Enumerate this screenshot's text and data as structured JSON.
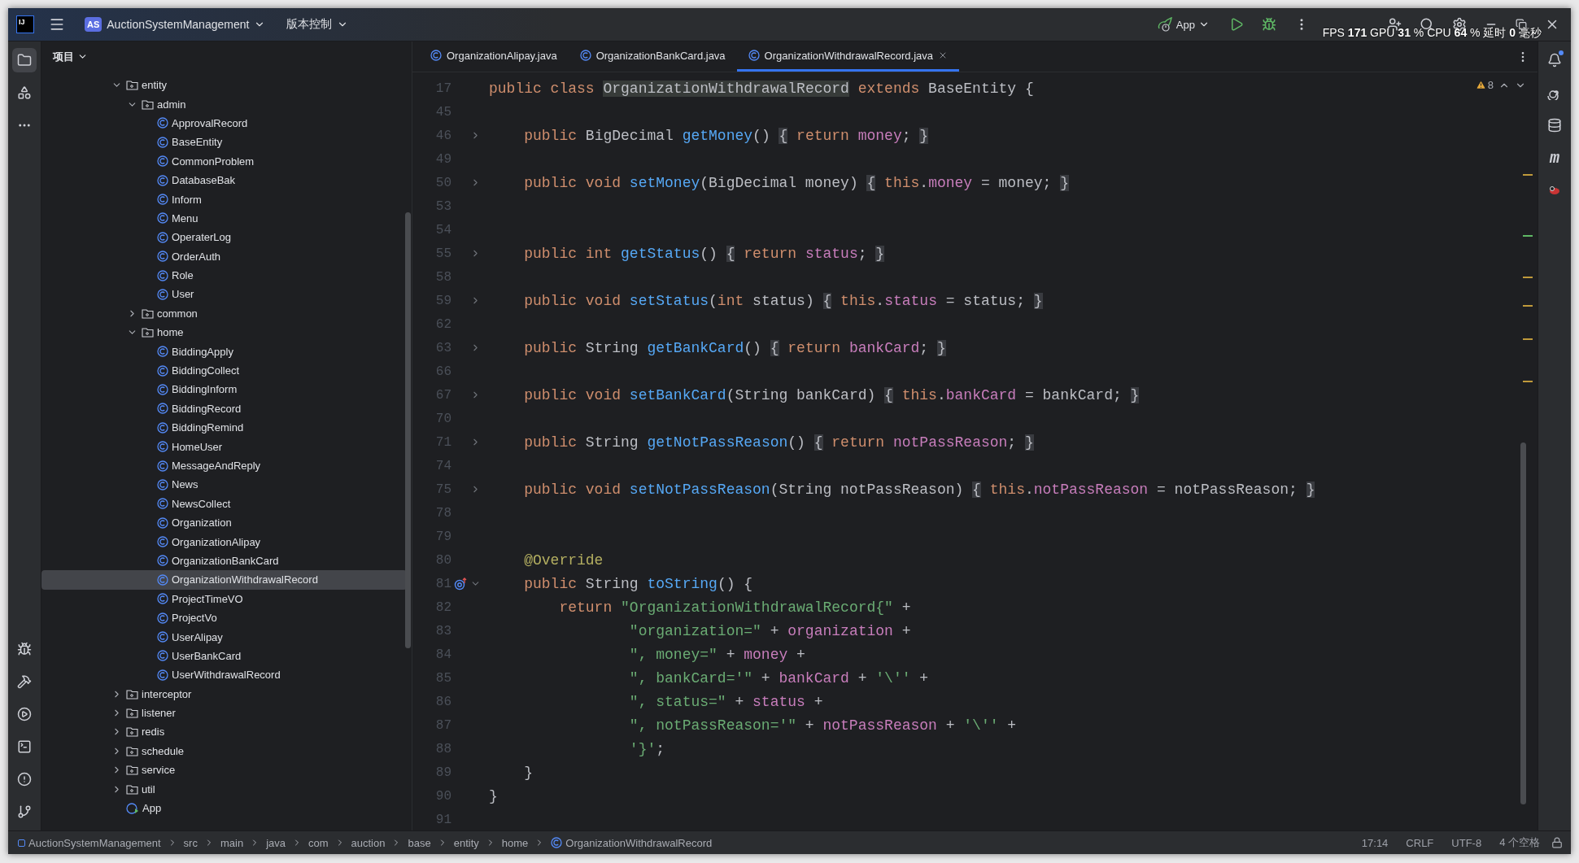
{
  "titlebar": {
    "logo_text": "IJ",
    "project_badge": "AS",
    "project_name": "AuctionSystemManagement",
    "vcs": "版本控制",
    "run_config": "App",
    "perf_overlay": "FPS **171** GPU **31** % CPU **64** % 延时 **0** 毫秒"
  },
  "right_strip": {
    "maven_label": "m"
  },
  "project": {
    "title": "项目",
    "tree": [
      {
        "label": "entity",
        "kind": "folder",
        "expanded": true,
        "selected": false,
        "children": [
          {
            "label": "admin",
            "kind": "folder",
            "expanded": true,
            "selected": false,
            "children": [
              {
                "label": "ApprovalRecord",
                "kind": "class",
                "selected": false
              },
              {
                "label": "BaseEntity",
                "kind": "class",
                "selected": false
              },
              {
                "label": "CommonProblem",
                "kind": "class",
                "selected": false
              },
              {
                "label": "DatabaseBak",
                "kind": "class",
                "selected": false
              },
              {
                "label": "Inform",
                "kind": "class",
                "selected": false
              },
              {
                "label": "Menu",
                "kind": "class",
                "selected": false
              },
              {
                "label": "OperaterLog",
                "kind": "class",
                "selected": false
              },
              {
                "label": "OrderAuth",
                "kind": "class",
                "selected": false
              },
              {
                "label": "Role",
                "kind": "class",
                "selected": false
              },
              {
                "label": "User",
                "kind": "class",
                "selected": false
              }
            ]
          },
          {
            "label": "common",
            "kind": "folder",
            "expanded": false,
            "selected": false
          },
          {
            "label": "home",
            "kind": "folder",
            "expanded": true,
            "selected": false,
            "children": [
              {
                "label": "BiddingApply",
                "kind": "class",
                "selected": false
              },
              {
                "label": "BiddingCollect",
                "kind": "class",
                "selected": false
              },
              {
                "label": "BiddingInform",
                "kind": "class",
                "selected": false
              },
              {
                "label": "BiddingRecord",
                "kind": "class",
                "selected": false
              },
              {
                "label": "BiddingRemind",
                "kind": "class",
                "selected": false
              },
              {
                "label": "HomeUser",
                "kind": "class",
                "selected": false
              },
              {
                "label": "MessageAndReply",
                "kind": "class",
                "selected": false
              },
              {
                "label": "News",
                "kind": "class",
                "selected": false
              },
              {
                "label": "NewsCollect",
                "kind": "class",
                "selected": false
              },
              {
                "label": "Organization",
                "kind": "class",
                "selected": false
              },
              {
                "label": "OrganizationAlipay",
                "kind": "class",
                "selected": false
              },
              {
                "label": "OrganizationBankCard",
                "kind": "class",
                "selected": false
              },
              {
                "label": "OrganizationWithdrawalRecord",
                "kind": "class",
                "selected": true
              },
              {
                "label": "ProjectTimeVO",
                "kind": "class",
                "selected": false
              },
              {
                "label": "ProjectVo",
                "kind": "class",
                "selected": false
              },
              {
                "label": "UserAlipay",
                "kind": "class",
                "selected": false
              },
              {
                "label": "UserBankCard",
                "kind": "class",
                "selected": false
              },
              {
                "label": "UserWithdrawalRecord",
                "kind": "class",
                "selected": false
              }
            ]
          }
        ]
      },
      {
        "label": "interceptor",
        "kind": "folder",
        "expanded": false,
        "selected": false
      },
      {
        "label": "listener",
        "kind": "folder",
        "expanded": false,
        "selected": false
      },
      {
        "label": "redis",
        "kind": "folder",
        "expanded": false,
        "selected": false
      },
      {
        "label": "schedule",
        "kind": "folder",
        "expanded": false,
        "selected": false
      },
      {
        "label": "service",
        "kind": "folder",
        "expanded": false,
        "selected": false
      },
      {
        "label": "util",
        "kind": "folder",
        "expanded": false,
        "selected": false
      },
      {
        "label": "App",
        "kind": "app",
        "selected": false
      }
    ]
  },
  "tabs": [
    {
      "label": "OrganizationAlipay.java",
      "selected": false
    },
    {
      "label": "OrganizationBankCard.java",
      "selected": false
    },
    {
      "label": "OrganizationWithdrawalRecord.java",
      "selected": true
    }
  ],
  "editor": {
    "warnings": "8",
    "lines": [
      {
        "number": "17",
        "tokens": [
          {
            "kind": "kw",
            "text": "public class "
          },
          {
            "kind": "highlight",
            "text": "OrganizationWithdrawalRecord"
          },
          {
            "kind": "kw",
            "text": " extends "
          },
          {
            "kind": "plain",
            "text": "BaseEntity {"
          }
        ]
      },
      {
        "number": "45"
      },
      {
        "number": "46",
        "fold_expanded": false,
        "tokens": [
          {
            "kind": "kw",
            "text": "    public "
          },
          {
            "kind": "plain",
            "text": "BigDecimal "
          },
          {
            "kind": "method",
            "text": "getMoney"
          },
          {
            "kind": "plain",
            "text": "() "
          },
          {
            "kind": "fold",
            "text": "{"
          },
          {
            "kind": "kw",
            "text": " return "
          },
          {
            "kind": "field",
            "text": "money"
          },
          {
            "kind": "plain",
            "text": "; "
          },
          {
            "kind": "fold",
            "text": "}"
          }
        ]
      },
      {
        "number": "49"
      },
      {
        "number": "50",
        "fold_expanded": false,
        "tokens": [
          {
            "kind": "kw",
            "text": "    public void "
          },
          {
            "kind": "method",
            "text": "setMoney"
          },
          {
            "kind": "plain",
            "text": "(BigDecimal money) "
          },
          {
            "kind": "fold",
            "text": "{"
          },
          {
            "kind": "kw",
            "text": " this"
          },
          {
            "kind": "plain",
            "text": "."
          },
          {
            "kind": "field",
            "text": "money"
          },
          {
            "kind": "plain",
            "text": " = money; "
          },
          {
            "kind": "fold",
            "text": "}"
          }
        ]
      },
      {
        "number": "53"
      },
      {
        "number": "54"
      },
      {
        "number": "55",
        "fold_expanded": false,
        "tokens": [
          {
            "kind": "kw",
            "text": "    public int "
          },
          {
            "kind": "method",
            "text": "getStatus"
          },
          {
            "kind": "plain",
            "text": "() "
          },
          {
            "kind": "fold",
            "text": "{"
          },
          {
            "kind": "kw",
            "text": " return "
          },
          {
            "kind": "field",
            "text": "status"
          },
          {
            "kind": "plain",
            "text": "; "
          },
          {
            "kind": "fold",
            "text": "}"
          }
        ]
      },
      {
        "number": "58"
      },
      {
        "number": "59",
        "fold_expanded": false,
        "tokens": [
          {
            "kind": "kw",
            "text": "    public void "
          },
          {
            "kind": "method",
            "text": "setStatus"
          },
          {
            "kind": "plain",
            "text": "("
          },
          {
            "kind": "kw",
            "text": "int "
          },
          {
            "kind": "plain",
            "text": "status) "
          },
          {
            "kind": "fold",
            "text": "{"
          },
          {
            "kind": "kw",
            "text": " this"
          },
          {
            "kind": "plain",
            "text": "."
          },
          {
            "kind": "field",
            "text": "status"
          },
          {
            "kind": "plain",
            "text": " = status; "
          },
          {
            "kind": "fold",
            "text": "}"
          }
        ]
      },
      {
        "number": "62"
      },
      {
        "number": "63",
        "fold_expanded": false,
        "tokens": [
          {
            "kind": "kw",
            "text": "    public "
          },
          {
            "kind": "plain",
            "text": "String "
          },
          {
            "kind": "method",
            "text": "getBankCard"
          },
          {
            "kind": "plain",
            "text": "() "
          },
          {
            "kind": "fold",
            "text": "{"
          },
          {
            "kind": "kw",
            "text": " return "
          },
          {
            "kind": "field",
            "text": "bankCard"
          },
          {
            "kind": "plain",
            "text": "; "
          },
          {
            "kind": "fold",
            "text": "}"
          }
        ]
      },
      {
        "number": "66"
      },
      {
        "number": "67",
        "fold_expanded": false,
        "tokens": [
          {
            "kind": "kw",
            "text": "    public void "
          },
          {
            "kind": "method",
            "text": "setBankCard"
          },
          {
            "kind": "plain",
            "text": "(String bankCard) "
          },
          {
            "kind": "fold",
            "text": "{"
          },
          {
            "kind": "kw",
            "text": " this"
          },
          {
            "kind": "plain",
            "text": "."
          },
          {
            "kind": "field",
            "text": "bankCard"
          },
          {
            "kind": "plain",
            "text": " = bankCard; "
          },
          {
            "kind": "fold",
            "text": "}"
          }
        ]
      },
      {
        "number": "70"
      },
      {
        "number": "71",
        "fold_expanded": false,
        "tokens": [
          {
            "kind": "kw",
            "text": "    public "
          },
          {
            "kind": "plain",
            "text": "String "
          },
          {
            "kind": "method",
            "text": "getNotPassReason"
          },
          {
            "kind": "plain",
            "text": "() "
          },
          {
            "kind": "fold",
            "text": "{"
          },
          {
            "kind": "kw",
            "text": " return "
          },
          {
            "kind": "field",
            "text": "notPassReason"
          },
          {
            "kind": "plain",
            "text": "; "
          },
          {
            "kind": "fold",
            "text": "}"
          }
        ]
      },
      {
        "number": "74"
      },
      {
        "number": "75",
        "fold_expanded": false,
        "tokens": [
          {
            "kind": "kw",
            "text": "    public void "
          },
          {
            "kind": "method",
            "text": "setNotPassReason"
          },
          {
            "kind": "plain",
            "text": "(String notPassReason) "
          },
          {
            "kind": "fold",
            "text": "{"
          },
          {
            "kind": "kw",
            "text": " this"
          },
          {
            "kind": "plain",
            "text": "."
          },
          {
            "kind": "field",
            "text": "notPassReason"
          },
          {
            "kind": "plain",
            "text": " = notPassReason; "
          },
          {
            "kind": "fold",
            "text": "}"
          }
        ]
      },
      {
        "number": "78"
      },
      {
        "number": "79"
      },
      {
        "number": "80",
        "tokens": [
          {
            "kind": "annotation",
            "text": "    @Override"
          }
        ]
      },
      {
        "number": "81",
        "fold_expanded": true,
        "overrides": true,
        "tokens": [
          {
            "kind": "kw",
            "text": "    public "
          },
          {
            "kind": "plain",
            "text": "String "
          },
          {
            "kind": "method",
            "text": "toString"
          },
          {
            "kind": "plain",
            "text": "() {"
          }
        ]
      },
      {
        "number": "82",
        "tokens": [
          {
            "kind": "kw",
            "text": "        return "
          },
          {
            "kind": "string",
            "text": "\"OrganizationWithdrawalRecord{\""
          },
          {
            "kind": "plain",
            "text": " +"
          }
        ]
      },
      {
        "number": "83",
        "tokens": [
          {
            "kind": "string",
            "text": "                \"organization=\""
          },
          {
            "kind": "plain",
            "text": " + "
          },
          {
            "kind": "field",
            "text": "organization"
          },
          {
            "kind": "plain",
            "text": " +"
          }
        ]
      },
      {
        "number": "84",
        "tokens": [
          {
            "kind": "string",
            "text": "                \", money=\""
          },
          {
            "kind": "plain",
            "text": " + "
          },
          {
            "kind": "field",
            "text": "money"
          },
          {
            "kind": "plain",
            "text": " +"
          }
        ]
      },
      {
        "number": "85",
        "tokens": [
          {
            "kind": "string",
            "text": "                \", bankCard='\""
          },
          {
            "kind": "plain",
            "text": " + "
          },
          {
            "kind": "field",
            "text": "bankCard"
          },
          {
            "kind": "plain",
            "text": " + "
          },
          {
            "kind": "string",
            "text": "'\\''"
          },
          {
            "kind": "plain",
            "text": " +"
          }
        ]
      },
      {
        "number": "86",
        "tokens": [
          {
            "kind": "string",
            "text": "                \", status=\""
          },
          {
            "kind": "plain",
            "text": " + "
          },
          {
            "kind": "field",
            "text": "status"
          },
          {
            "kind": "plain",
            "text": " +"
          }
        ]
      },
      {
        "number": "87",
        "tokens": [
          {
            "kind": "string",
            "text": "                \", notPassReason='\""
          },
          {
            "kind": "plain",
            "text": " + "
          },
          {
            "kind": "field",
            "text": "notPassReason"
          },
          {
            "kind": "plain",
            "text": " + "
          },
          {
            "kind": "string",
            "text": "'\\''"
          },
          {
            "kind": "plain",
            "text": " +"
          }
        ]
      },
      {
        "number": "88",
        "tokens": [
          {
            "kind": "string",
            "text": "                '}'"
          },
          {
            "kind": "plain",
            "text": ";"
          }
        ]
      },
      {
        "number": "89",
        "tokens": [
          {
            "kind": "plain",
            "text": "    }"
          }
        ]
      },
      {
        "number": "90",
        "tokens": [
          {
            "kind": "plain",
            "text": "}"
          }
        ]
      },
      {
        "number": "91"
      }
    ]
  },
  "status_bar": {
    "breadcrumbs": [
      {
        "label": "AuctionSystemManagement",
        "kind": "module"
      },
      {
        "label": "src",
        "kind": "dir"
      },
      {
        "label": "main",
        "kind": "dir"
      },
      {
        "label": "java",
        "kind": "dir"
      },
      {
        "label": "com",
        "kind": "dir"
      },
      {
        "label": "auction",
        "kind": "dir"
      },
      {
        "label": "base",
        "kind": "dir"
      },
      {
        "label": "entity",
        "kind": "dir"
      },
      {
        "label": "home",
        "kind": "dir"
      },
      {
        "label": "OrganizationWithdrawalRecord",
        "kind": "class"
      }
    ],
    "position": "17:14",
    "line_separator": "CRLF",
    "encoding": "UTF-8",
    "indent": "4 个空格"
  }
}
